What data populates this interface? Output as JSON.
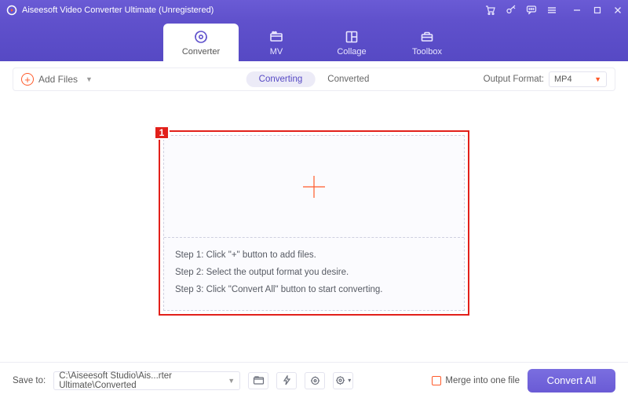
{
  "titlebar": {
    "title": "Aiseesoft Video Converter Ultimate (Unregistered)"
  },
  "nav": {
    "tabs": [
      {
        "label": "Converter",
        "active": true
      },
      {
        "label": "MV",
        "active": false
      },
      {
        "label": "Collage",
        "active": false
      },
      {
        "label": "Toolbox",
        "active": false
      }
    ]
  },
  "toolbar": {
    "add_files_label": "Add Files",
    "seg_converting_label": "Converting",
    "seg_converted_label": "Converted",
    "output_format_label": "Output Format:",
    "output_format_value": "MP4"
  },
  "annotation": {
    "badge": "1"
  },
  "dropzone": {
    "step1": "Step 1: Click \"+\" button to add files.",
    "step2": "Step 2: Select the output format you desire.",
    "step3": "Step 3: Click \"Convert All\" button to start converting."
  },
  "bottombar": {
    "save_to_label": "Save to:",
    "save_to_path": "C:\\Aiseesoft Studio\\Ais...rter Ultimate\\Converted",
    "merge_label": "Merge into one file",
    "convert_all_label": "Convert All"
  }
}
